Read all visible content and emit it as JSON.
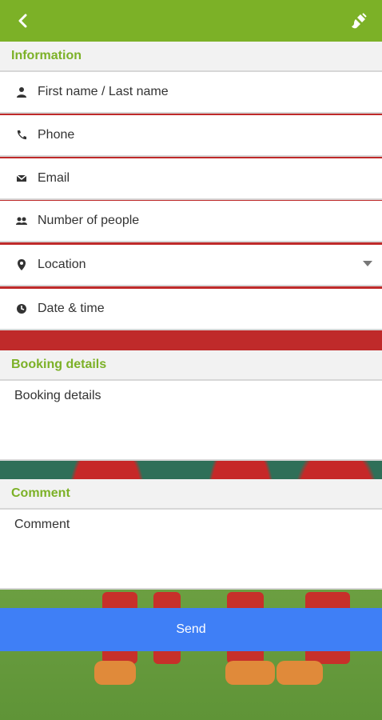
{
  "colors": {
    "accent": "#7cb127",
    "send": "#3f7ff6"
  },
  "topbar": {
    "back_icon": "back-chevron-icon",
    "right_icon": "brush-icon"
  },
  "sections": {
    "information": "Information",
    "booking": "Booking details",
    "comment": "Comment"
  },
  "fields": [
    {
      "icon": "person-icon",
      "label": "First name / Last name"
    },
    {
      "icon": "phone-icon",
      "label": "Phone"
    },
    {
      "icon": "email-icon",
      "label": "Email"
    },
    {
      "icon": "people-icon",
      "label": "Number of people"
    },
    {
      "icon": "location-pin-icon",
      "label": "Location",
      "dropdown": true
    },
    {
      "icon": "clock-icon",
      "label": "Date & time"
    }
  ],
  "booking_placeholder": "Booking details",
  "comment_placeholder": "Comment",
  "send_label": "Send"
}
